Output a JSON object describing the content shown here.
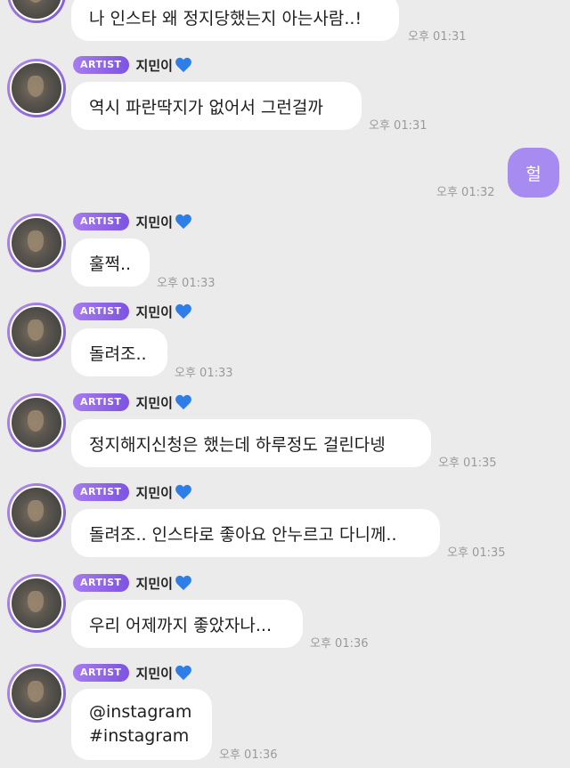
{
  "messages": [
    {
      "text": "나 인스타 왜 정지당했는지 아는사람..!",
      "time": "오후 01:31"
    },
    {
      "badge": "ARTIST",
      "sender": "지민이",
      "text": "역시 파란딱지가 없어서 그런걸까",
      "time": "오후 01:31"
    },
    {
      "mine": true,
      "text": "헐",
      "time": "오후 01:32"
    },
    {
      "badge": "ARTIST",
      "sender": "지민이",
      "text": "훌쩍..",
      "time": "오후 01:33"
    },
    {
      "badge": "ARTIST",
      "sender": "지민이",
      "text": "돌려조..",
      "time": "오후 01:33"
    },
    {
      "badge": "ARTIST",
      "sender": "지민이",
      "text": "정지해지신청은 했는데 하루정도 걸린다넹",
      "time": "오후 01:35"
    },
    {
      "badge": "ARTIST",
      "sender": "지민이",
      "text": "돌려조.. 인스타로 좋아요 안누르고 다니께..",
      "time": "오후 01:35"
    },
    {
      "badge": "ARTIST",
      "sender": "지민이",
      "text": "우리 어제까지 좋았자나...",
      "time": "오후 01:36"
    },
    {
      "badge": "ARTIST",
      "sender": "지민이",
      "line1": "@instagram",
      "line2": "#instagram",
      "time": "오후 01:36"
    }
  ],
  "colors": {
    "badge": "#8f65e8",
    "my_bubble": "#a88bf0",
    "heart": "#2f7ee8",
    "background": "#ebebeb"
  },
  "icons": {
    "heart": "blue-heart-icon"
  }
}
